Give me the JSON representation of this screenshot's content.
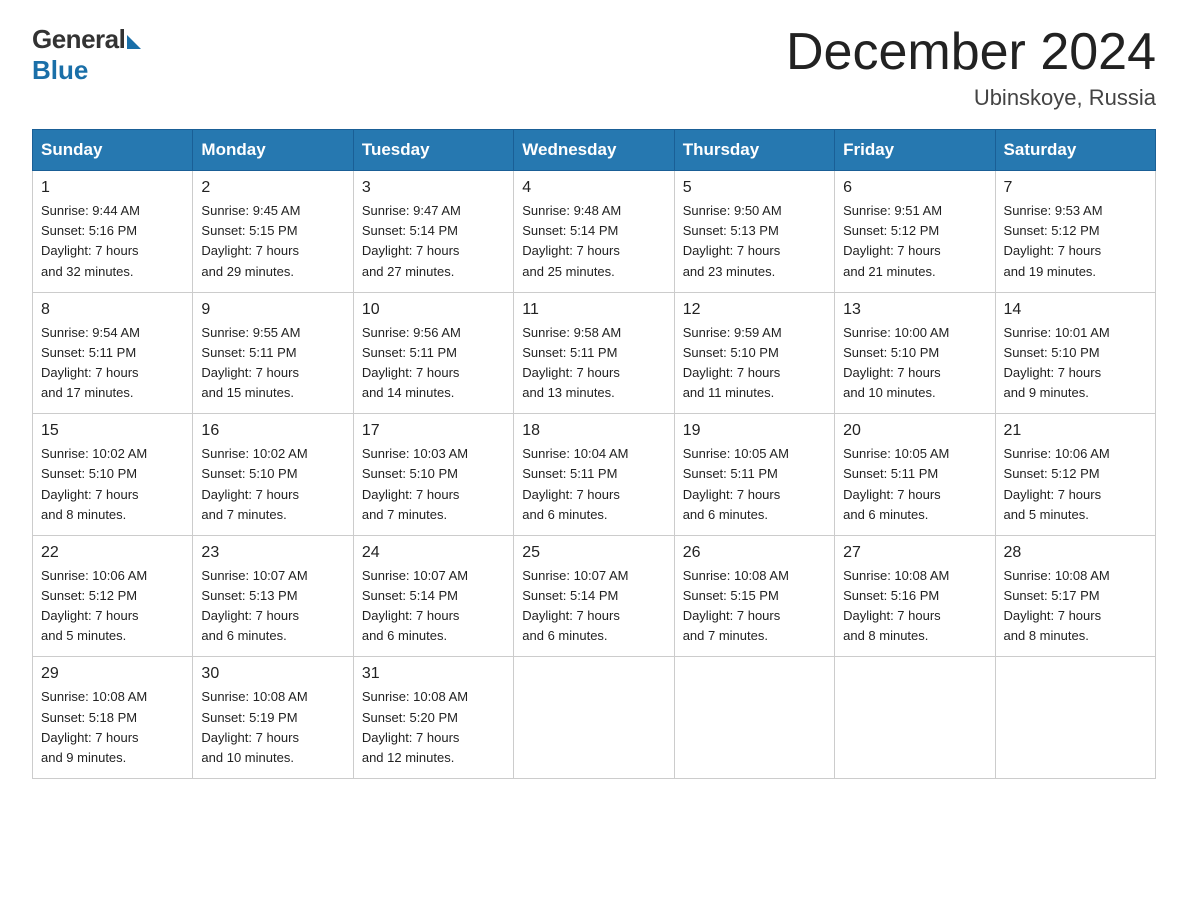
{
  "logo": {
    "general": "General",
    "blue": "Blue"
  },
  "title": {
    "month_year": "December 2024",
    "location": "Ubinskoye, Russia"
  },
  "weekdays": [
    "Sunday",
    "Monday",
    "Tuesday",
    "Wednesday",
    "Thursday",
    "Friday",
    "Saturday"
  ],
  "weeks": [
    [
      {
        "day": "1",
        "sunrise": "9:44 AM",
        "sunset": "5:16 PM",
        "daylight": "7 hours and 32 minutes."
      },
      {
        "day": "2",
        "sunrise": "9:45 AM",
        "sunset": "5:15 PM",
        "daylight": "7 hours and 29 minutes."
      },
      {
        "day": "3",
        "sunrise": "9:47 AM",
        "sunset": "5:14 PM",
        "daylight": "7 hours and 27 minutes."
      },
      {
        "day": "4",
        "sunrise": "9:48 AM",
        "sunset": "5:14 PM",
        "daylight": "7 hours and 25 minutes."
      },
      {
        "day": "5",
        "sunrise": "9:50 AM",
        "sunset": "5:13 PM",
        "daylight": "7 hours and 23 minutes."
      },
      {
        "day": "6",
        "sunrise": "9:51 AM",
        "sunset": "5:12 PM",
        "daylight": "7 hours and 21 minutes."
      },
      {
        "day": "7",
        "sunrise": "9:53 AM",
        "sunset": "5:12 PM",
        "daylight": "7 hours and 19 minutes."
      }
    ],
    [
      {
        "day": "8",
        "sunrise": "9:54 AM",
        "sunset": "5:11 PM",
        "daylight": "7 hours and 17 minutes."
      },
      {
        "day": "9",
        "sunrise": "9:55 AM",
        "sunset": "5:11 PM",
        "daylight": "7 hours and 15 minutes."
      },
      {
        "day": "10",
        "sunrise": "9:56 AM",
        "sunset": "5:11 PM",
        "daylight": "7 hours and 14 minutes."
      },
      {
        "day": "11",
        "sunrise": "9:58 AM",
        "sunset": "5:11 PM",
        "daylight": "7 hours and 13 minutes."
      },
      {
        "day": "12",
        "sunrise": "9:59 AM",
        "sunset": "5:10 PM",
        "daylight": "7 hours and 11 minutes."
      },
      {
        "day": "13",
        "sunrise": "10:00 AM",
        "sunset": "5:10 PM",
        "daylight": "7 hours and 10 minutes."
      },
      {
        "day": "14",
        "sunrise": "10:01 AM",
        "sunset": "5:10 PM",
        "daylight": "7 hours and 9 minutes."
      }
    ],
    [
      {
        "day": "15",
        "sunrise": "10:02 AM",
        "sunset": "5:10 PM",
        "daylight": "7 hours and 8 minutes."
      },
      {
        "day": "16",
        "sunrise": "10:02 AM",
        "sunset": "5:10 PM",
        "daylight": "7 hours and 7 minutes."
      },
      {
        "day": "17",
        "sunrise": "10:03 AM",
        "sunset": "5:10 PM",
        "daylight": "7 hours and 7 minutes."
      },
      {
        "day": "18",
        "sunrise": "10:04 AM",
        "sunset": "5:11 PM",
        "daylight": "7 hours and 6 minutes."
      },
      {
        "day": "19",
        "sunrise": "10:05 AM",
        "sunset": "5:11 PM",
        "daylight": "7 hours and 6 minutes."
      },
      {
        "day": "20",
        "sunrise": "10:05 AM",
        "sunset": "5:11 PM",
        "daylight": "7 hours and 6 minutes."
      },
      {
        "day": "21",
        "sunrise": "10:06 AM",
        "sunset": "5:12 PM",
        "daylight": "7 hours and 5 minutes."
      }
    ],
    [
      {
        "day": "22",
        "sunrise": "10:06 AM",
        "sunset": "5:12 PM",
        "daylight": "7 hours and 5 minutes."
      },
      {
        "day": "23",
        "sunrise": "10:07 AM",
        "sunset": "5:13 PM",
        "daylight": "7 hours and 6 minutes."
      },
      {
        "day": "24",
        "sunrise": "10:07 AM",
        "sunset": "5:14 PM",
        "daylight": "7 hours and 6 minutes."
      },
      {
        "day": "25",
        "sunrise": "10:07 AM",
        "sunset": "5:14 PM",
        "daylight": "7 hours and 6 minutes."
      },
      {
        "day": "26",
        "sunrise": "10:08 AM",
        "sunset": "5:15 PM",
        "daylight": "7 hours and 7 minutes."
      },
      {
        "day": "27",
        "sunrise": "10:08 AM",
        "sunset": "5:16 PM",
        "daylight": "7 hours and 8 minutes."
      },
      {
        "day": "28",
        "sunrise": "10:08 AM",
        "sunset": "5:17 PM",
        "daylight": "7 hours and 8 minutes."
      }
    ],
    [
      {
        "day": "29",
        "sunrise": "10:08 AM",
        "sunset": "5:18 PM",
        "daylight": "7 hours and 9 minutes."
      },
      {
        "day": "30",
        "sunrise": "10:08 AM",
        "sunset": "5:19 PM",
        "daylight": "7 hours and 10 minutes."
      },
      {
        "day": "31",
        "sunrise": "10:08 AM",
        "sunset": "5:20 PM",
        "daylight": "7 hours and 12 minutes."
      },
      null,
      null,
      null,
      null
    ]
  ],
  "labels": {
    "sunrise": "Sunrise:",
    "sunset": "Sunset:",
    "daylight": "Daylight:"
  }
}
